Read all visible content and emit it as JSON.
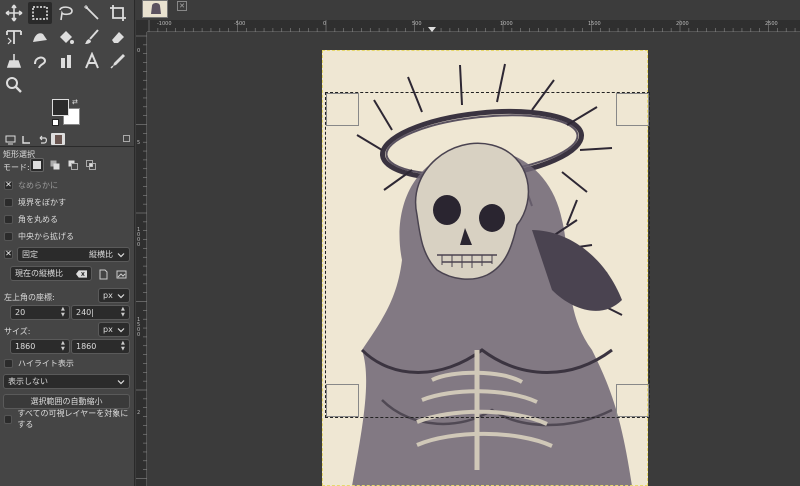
{
  "tool_options": {
    "panel_title": "矩形選択",
    "mode_label": "モード:",
    "antialias_label": "なめらかに",
    "feather_label": "境界をぼかす",
    "rounded_label": "角を丸める",
    "expand_center_label": "中央から拡げる",
    "fixed_label": "固定",
    "fixed_option": "縦横比",
    "ratio_value": "現在の縦横比",
    "position_label": "左上角の座標:",
    "position_unit": "px",
    "pos_x": "20",
    "pos_y": "240|",
    "size_label": "サイズ:",
    "size_unit": "px",
    "size_w": "1860",
    "size_h": "1860",
    "highlight_label": "ハイライト表示",
    "guides_option": "表示しない",
    "auto_shrink_label": "選択範囲の自動縮小",
    "sample_merged_label": "すべての可視レイヤーを対象にする"
  },
  "ruler": {
    "top_labels": [
      "-1000",
      "-500",
      "0",
      "500",
      "1000",
      "1500",
      "2000",
      "2500"
    ],
    "left_labels": [
      "0",
      "5",
      "1\n0\n0\n0",
      "1\n5\n0\n0",
      "2"
    ]
  },
  "colors": {
    "foreground": "#2b2b2b",
    "background": "#ffffff",
    "paper": "#efe7d3",
    "ink": "#3f3846"
  }
}
